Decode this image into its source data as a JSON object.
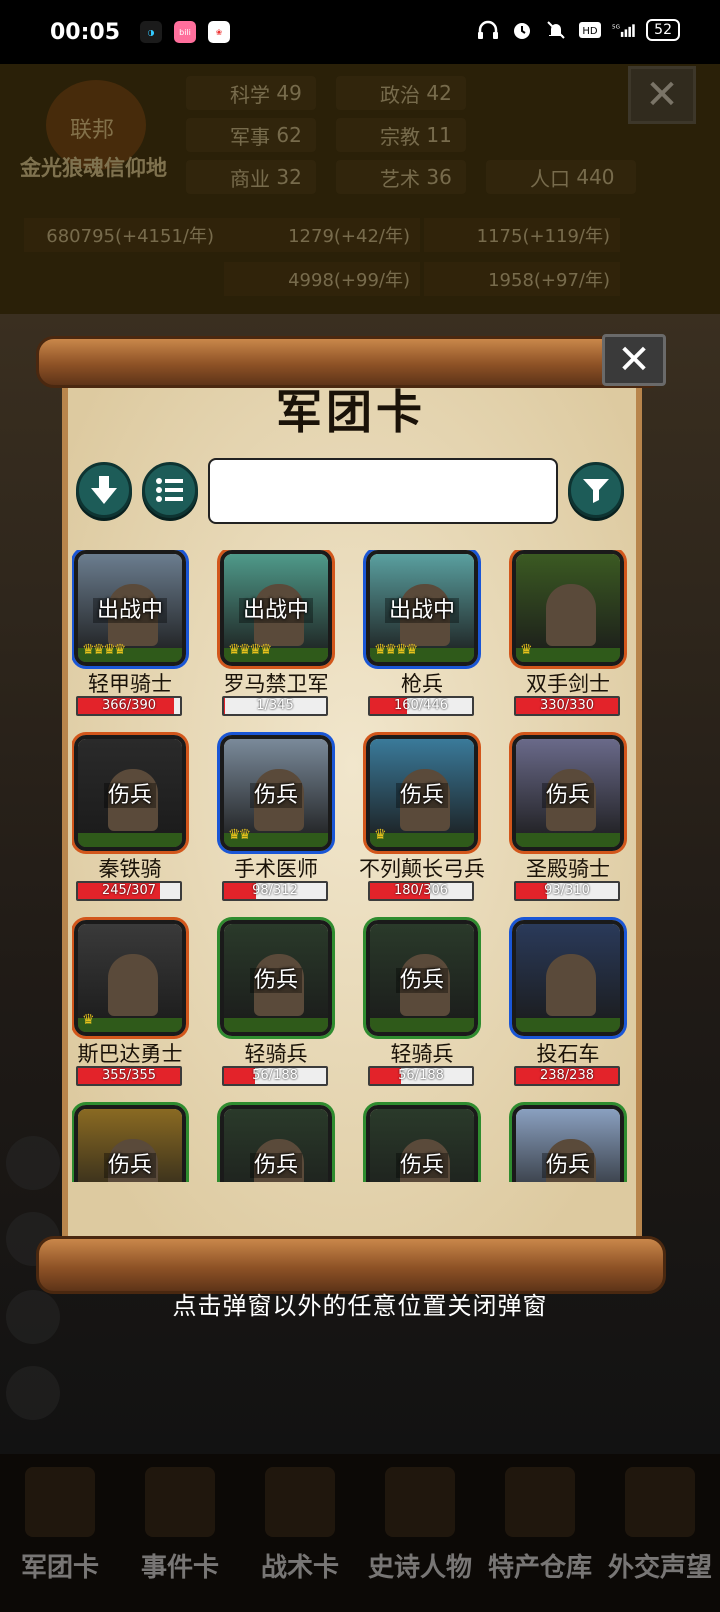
{
  "statusbar": {
    "time": "00:05",
    "battery": "52",
    "app_icons": [
      "headset-app-icon",
      "bilibili-icon",
      "meitu-icon"
    ],
    "right_icons": [
      "headphones-icon",
      "alarm-icon",
      "mute-icon",
      "hd-icon",
      "5g-signal-icon"
    ]
  },
  "background": {
    "emblem": "联邦",
    "region_name": "金光狼魂信仰地",
    "stats": [
      {
        "label": "科学",
        "value": "49"
      },
      {
        "label": "政治",
        "value": "42"
      },
      {
        "label": "军事",
        "value": "62"
      },
      {
        "label": "宗教",
        "value": "11"
      },
      {
        "label": "商业",
        "value": "32"
      },
      {
        "label": "艺术",
        "value": "36"
      },
      {
        "label": "人口",
        "value": "440"
      }
    ],
    "resources": [
      "680795(+4151/年)",
      "1279(+42/年)",
      "1175(+119/年)",
      "4998(+99/年)",
      "1958(+97/年)"
    ],
    "nav": [
      "军团卡",
      "事件卡",
      "战术卡",
      "史诗人物",
      "特产仓库",
      "外交声望"
    ]
  },
  "popup": {
    "title": "军团卡",
    "search_value": "",
    "close_icon": "close-icon",
    "buttons": [
      "sort-down-icon",
      "list-icon",
      "filter-icon"
    ],
    "units": [
      {
        "name": "轻甲骑士",
        "hp": "366/390",
        "ratio": 0.94,
        "status": "出战中",
        "frame": "blue",
        "crowns": 4,
        "bg": "#6b7d8f"
      },
      {
        "name": "罗马禁卫军",
        "hp": "1/345",
        "ratio": 0.01,
        "status": "出战中",
        "frame": "orange",
        "crowns": 4,
        "bg": "#4f9a8a"
      },
      {
        "name": "枪兵",
        "hp": "160/446",
        "ratio": 0.36,
        "status": "出战中",
        "frame": "blue",
        "crowns": 4,
        "bg": "#5aa0a0"
      },
      {
        "name": "双手剑士",
        "hp": "330/330",
        "ratio": 1.0,
        "status": "",
        "frame": "orange",
        "crowns": 1,
        "bg": "#3b5a22"
      },
      {
        "name": "秦铁骑",
        "hp": "245/307",
        "ratio": 0.8,
        "status": "伤兵",
        "frame": "orange",
        "crowns": 0,
        "bg": "#2a2a2a"
      },
      {
        "name": "手术医师",
        "hp": "98/312",
        "ratio": 0.31,
        "status": "伤兵",
        "frame": "blue",
        "crowns": 2,
        "bg": "#7a8a9a"
      },
      {
        "name": "不列颠长弓兵",
        "hp": "180/306",
        "ratio": 0.59,
        "status": "伤兵",
        "frame": "orange",
        "crowns": 1,
        "bg": "#3a7a9a"
      },
      {
        "name": "圣殿骑士",
        "hp": "93/310",
        "ratio": 0.3,
        "status": "伤兵",
        "frame": "orange",
        "crowns": 0,
        "bg": "#6a6a8a"
      },
      {
        "name": "斯巴达勇士",
        "hp": "355/355",
        "ratio": 1.0,
        "status": "",
        "frame": "orange",
        "crowns": 1,
        "bg": "#3a3a3a"
      },
      {
        "name": "轻骑兵",
        "hp": "56/188",
        "ratio": 0.3,
        "status": "伤兵",
        "frame": "green",
        "crowns": 0,
        "bg": "#2a3a2a"
      },
      {
        "name": "轻骑兵",
        "hp": "56/188",
        "ratio": 0.3,
        "status": "伤兵",
        "frame": "green",
        "crowns": 0,
        "bg": "#2a3a2a"
      },
      {
        "name": "投石车",
        "hp": "238/238",
        "ratio": 1.0,
        "status": "",
        "frame": "blue",
        "crowns": 0,
        "bg": "#2a3a5a"
      },
      {
        "name": "",
        "hp": "",
        "ratio": 0,
        "status": "伤兵",
        "frame": "green",
        "crowns": 0,
        "bg": "#8a6a22"
      },
      {
        "name": "",
        "hp": "",
        "ratio": 0,
        "status": "伤兵",
        "frame": "green",
        "crowns": 0,
        "bg": "#2a3a2a"
      },
      {
        "name": "",
        "hp": "",
        "ratio": 0,
        "status": "伤兵",
        "frame": "green",
        "crowns": 0,
        "bg": "#2a3a2a"
      },
      {
        "name": "",
        "hp": "",
        "ratio": 0,
        "status": "伤兵",
        "frame": "green",
        "crowns": 0,
        "bg": "#8aa0c0"
      }
    ]
  },
  "hint": "点击弹窗以外的任意位置关闭弹窗"
}
